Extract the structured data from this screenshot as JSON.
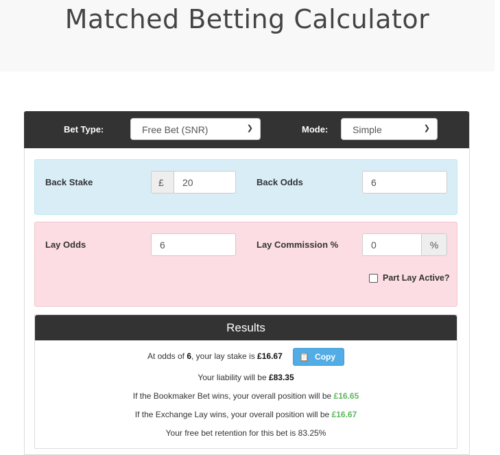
{
  "page": {
    "title": "Matched Betting Calculator"
  },
  "controls": {
    "bet_type_label": "Bet Type:",
    "bet_type_value": "Free Bet (SNR)",
    "mode_label": "Mode:",
    "mode_value": "Simple"
  },
  "back": {
    "stake_label": "Back Stake",
    "currency": "£",
    "stake_value": "20",
    "odds_label": "Back Odds",
    "odds_value": "6"
  },
  "lay": {
    "odds_label": "Lay Odds",
    "odds_value": "6",
    "commission_label": "Lay Commission %",
    "commission_value": "0",
    "percent": "%",
    "part_lay_label": "Part Lay Active?",
    "part_lay_checked": false
  },
  "results": {
    "title": "Results",
    "line1_pre": "At odds of ",
    "odds": "6",
    "line1_mid": ", your lay stake is ",
    "lay_stake": "£16.67",
    "copy_label": "Copy",
    "line2_pre": "Your liability will be ",
    "liability": "£83.35",
    "line3_pre": "If the Bookmaker Bet wins, your overall position will be ",
    "bookie_win": "£16.65",
    "line4_pre": "If the Exchange Lay wins, your overall position will be ",
    "lay_win": "£16.67",
    "line5_pre": "Your free bet retention for this bet is ",
    "retention": "83.25%"
  },
  "colors": {
    "header_bar": "#333333",
    "back_panel": "#d9edf7",
    "lay_panel": "#fcdde3",
    "positive": "#5cb85c",
    "copy_button": "#52ade6"
  }
}
